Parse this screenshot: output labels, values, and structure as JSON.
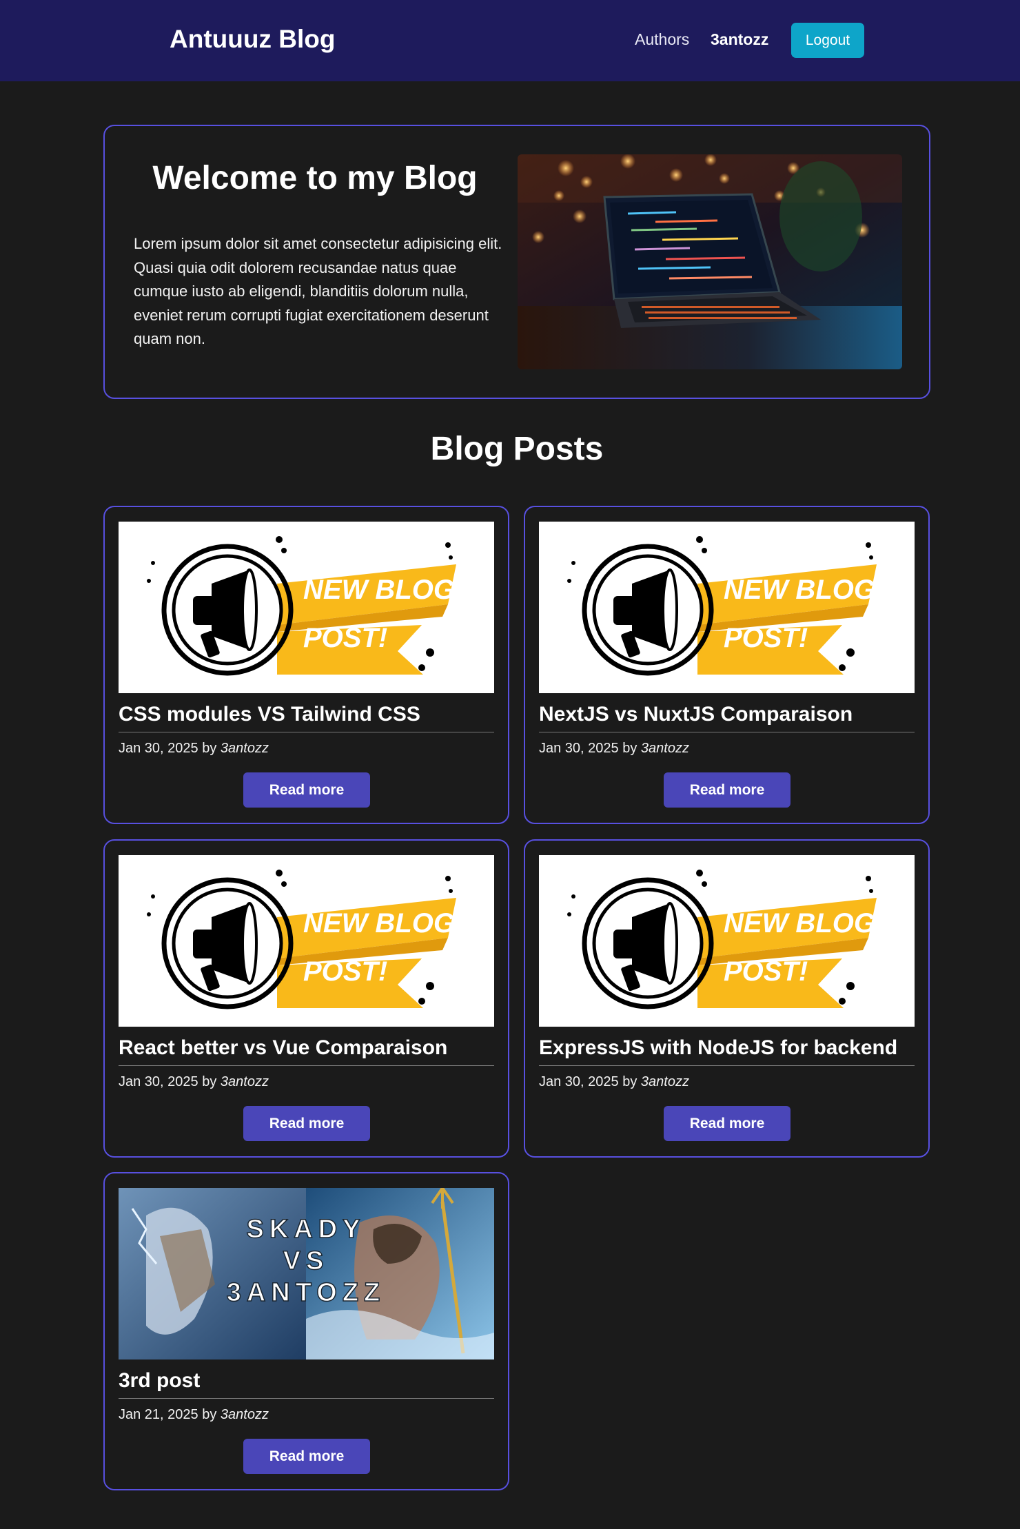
{
  "header": {
    "brand": "Antuuuz Blog",
    "nav_authors": "Authors",
    "nav_user": "3antozz",
    "logout_label": "Logout",
    "bg_color": "#1e1b5c",
    "logout_color": "#0ea5c9"
  },
  "hero": {
    "title": "Welcome to my Blog",
    "text": "Lorem ipsum dolor sit amet consectetur adipisicing elit. Quasi quia odit dolorem recusandae natus quae cumque iusto ab eligendi, blanditiis dolorum nulla, eveniet rerum corrupti fugiat exercitationem deserunt quam non.",
    "image": "laptop-code-photo"
  },
  "section_title": "Blog Posts",
  "posts": [
    {
      "title": "CSS modules VS Tailwind CSS",
      "date": "Jan 30, 2025",
      "by": "by",
      "author": "3antozz",
      "read_more": "Read more",
      "banner_line1": "NEW BLOG",
      "banner_line2": "POST!"
    },
    {
      "title": "NextJS vs NuxtJS Comparaison",
      "date": "Jan 30, 2025",
      "by": "by",
      "author": "3antozz",
      "read_more": "Read more",
      "banner_line1": "NEW BLOG",
      "banner_line2": "POST!"
    },
    {
      "title": "React better vs Vue Comparaison",
      "date": "Jan 30, 2025",
      "by": "by",
      "author": "3antozz",
      "read_more": "Read more",
      "banner_line1": "NEW BLOG",
      "banner_line2": "POST!"
    },
    {
      "title": "ExpressJS with NodeJS for backend",
      "date": "Jan 30, 2025",
      "by": "by",
      "author": "3antozz",
      "read_more": "Read more",
      "banner_line1": "NEW BLOG",
      "banner_line2": "POST!"
    },
    {
      "title": "3rd post",
      "date": "Jan 21, 2025",
      "by": "by",
      "author": "3antozz",
      "read_more": "Read more",
      "image_text": [
        "SKADY",
        "VS",
        "3ANTOZZ"
      ]
    }
  ],
  "colors": {
    "accent_border": "#5850e0",
    "button": "#4a46b8",
    "page_bg": "#1b1b1b",
    "banner_yellow": "#f9b91a"
  }
}
